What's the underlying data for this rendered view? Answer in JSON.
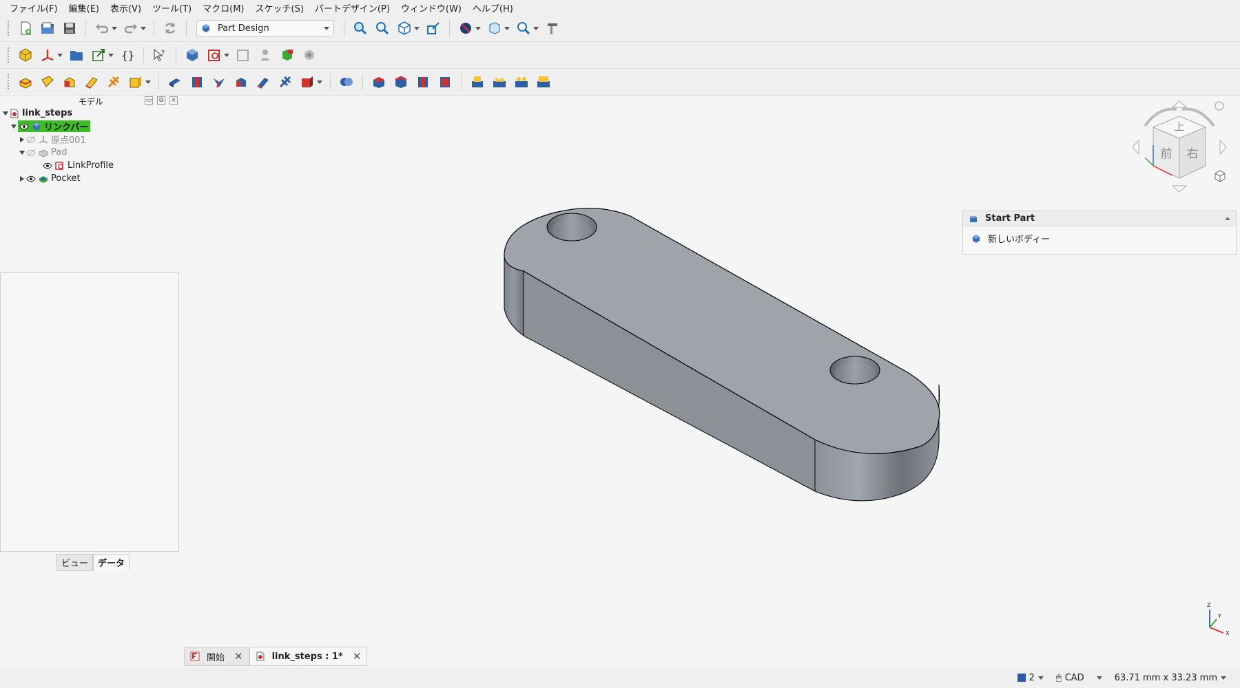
{
  "menu": [
    "ファイル(F)",
    "編集(E)",
    "表示(V)",
    "ツール(T)",
    "マクロ(M)",
    "スケッチ(S)",
    "パートデザイン(P)",
    "ウィンドウ(W)",
    "ヘルプ(H)"
  ],
  "workbench": {
    "selected": "Part Design"
  },
  "combo_view": {
    "title": "モデル",
    "tree": {
      "root": "link_steps",
      "body": "リンクバー",
      "origin": "原点001",
      "pad": "Pad",
      "sketch": "LinkProfile",
      "pocket": "Pocket"
    },
    "tabs": {
      "view": "ビュー",
      "data": "データ"
    }
  },
  "task_panel": {
    "title": "Start Part",
    "item": "新しいボディー"
  },
  "navcube": {
    "top": "上",
    "front": "前",
    "right": "右"
  },
  "axes": {
    "x": "X",
    "y": "Y",
    "z": "Z"
  },
  "doc_tabs": {
    "start": "開始",
    "doc": "link_steps : 1*"
  },
  "status": {
    "layers": "2",
    "nav_style": "CAD",
    "dimensions": "63.71 mm x 33.23 mm"
  },
  "colors": {
    "selection": "#3ebc27",
    "part": "#9fa3a8",
    "body_blue": "#2d5aa8"
  }
}
